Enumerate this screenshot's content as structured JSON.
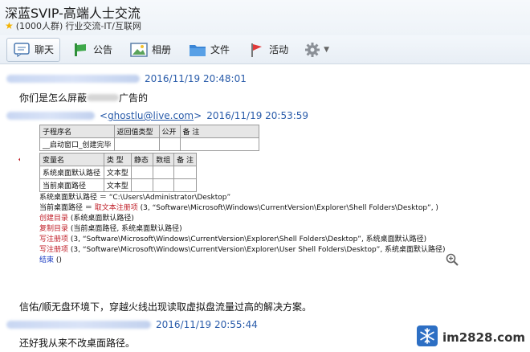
{
  "header": {
    "title": "深蓝SVIP-高端人士交流",
    "member_count": "(1000人群)",
    "category": "行业交流-IT/互联网"
  },
  "toolbar": {
    "tabs": [
      {
        "label": "聊天",
        "icon": "chat-icon"
      },
      {
        "label": "公告",
        "icon": "announcement-icon"
      },
      {
        "label": "相册",
        "icon": "photo-icon"
      },
      {
        "label": "文件",
        "icon": "folder-icon"
      },
      {
        "label": "活动",
        "icon": "flag-icon"
      }
    ],
    "settings_icon": "gear-icon"
  },
  "messages": [
    {
      "time": "2016/11/19 20:48:01",
      "text": "你们是怎么屏蔽",
      "text_after": "广告的"
    },
    {
      "email": "ghostlu@live.com",
      "time": "2016/11/19 20:53:59",
      "open_bracket": "<",
      "close_bracket": ">"
    },
    {
      "text": "信佑/顺无盘环境下，穿越火线出现读取虚拟盘流量过高的解决方案。"
    },
    {
      "time": "2016/11/19 20:55:44",
      "text": "还好我从来不改桌面路径。"
    }
  ],
  "embed": {
    "table1": {
      "headers": [
        "子程序名",
        "返回值类型",
        "公开",
        "备 注"
      ],
      "rows": [
        [
          "__启动窗口_创建完毕",
          "",
          "",
          ""
        ]
      ]
    },
    "table2": {
      "headers": [
        "变量名",
        "类 型",
        "静态",
        "数组",
        "备 注"
      ],
      "rows": [
        [
          "系统桌面默认路径",
          "文本型",
          "",
          "",
          ""
        ],
        [
          "当前桌面路径",
          "文本型",
          "",
          "",
          ""
        ]
      ]
    },
    "code_lines": [
      {
        "color": "black",
        "text": "系统桌面默认路径 ＝ “C:\\Users\\Administrator\\Desktop”"
      },
      {
        "color": "mixed",
        "prefix": "当前桌面路径 ＝ ",
        "red": "取文本注册项",
        "suffix": " (3, “Software\\Microsoft\\Windows\\CurrentVersion\\Explorer\\Shell Folders\\Desktop”, )"
      },
      {
        "color": "red",
        "text": "创建目录",
        "suffix": " (系统桌面默认路径)"
      },
      {
        "color": "red",
        "text": "复制目录",
        "suffix": " (当前桌面路径, 系统桌面默认路径)"
      },
      {
        "color": "red",
        "text": "写注册项",
        "suffix": " (3, “Software\\Microsoft\\Windows\\CurrentVersion\\Explorer\\Shell Folders\\Desktop”, 系统桌面默认路径)"
      },
      {
        "color": "red",
        "text": "写注册项",
        "suffix": " (3, “Software\\Microsoft\\Windows\\CurrentVersion\\Explorer\\User Shell Folders\\Desktop”, 系统桌面默认路径)"
      },
      {
        "color": "blue",
        "text": "结束",
        "suffix": " ()"
      }
    ]
  },
  "watermark": "im2828.com"
}
